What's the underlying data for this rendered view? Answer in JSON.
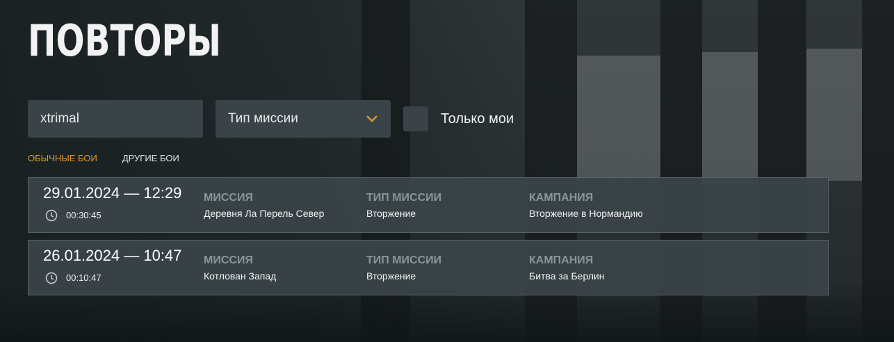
{
  "page": {
    "title": "ПОВТОРЫ"
  },
  "filters": {
    "search_value": "xtrimal",
    "mission_type_placeholder": "Тип миссии",
    "only_mine_label": "Только мои"
  },
  "tabs": [
    {
      "label": "ОБЫЧНЫЕ БОИ",
      "active": true
    },
    {
      "label": "ДРУГИЕ БОИ",
      "active": false
    }
  ],
  "column_headers": {
    "mission": "МИССИЯ",
    "mission_type": "ТИП МИССИИ",
    "campaign": "КАМПАНИЯ"
  },
  "replays": [
    {
      "datetime": "29.01.2024 — 12:29",
      "duration": "00:30:45",
      "mission": "Деревня Ла Перель Север",
      "mission_type": "Вторжение",
      "campaign": "Вторжение в Нормандию"
    },
    {
      "datetime": "26.01.2024 — 10:47",
      "duration": "00:10:47",
      "mission": "Котлован Запад",
      "mission_type": "Вторжение",
      "campaign": "Битва за Берлин"
    }
  ],
  "colors": {
    "accent": "#e49a2c",
    "panel": "#3a4448",
    "row": "#3a4448"
  },
  "icons": {
    "select_arrow": "chevron-down-icon",
    "duration": "clock-icon"
  }
}
